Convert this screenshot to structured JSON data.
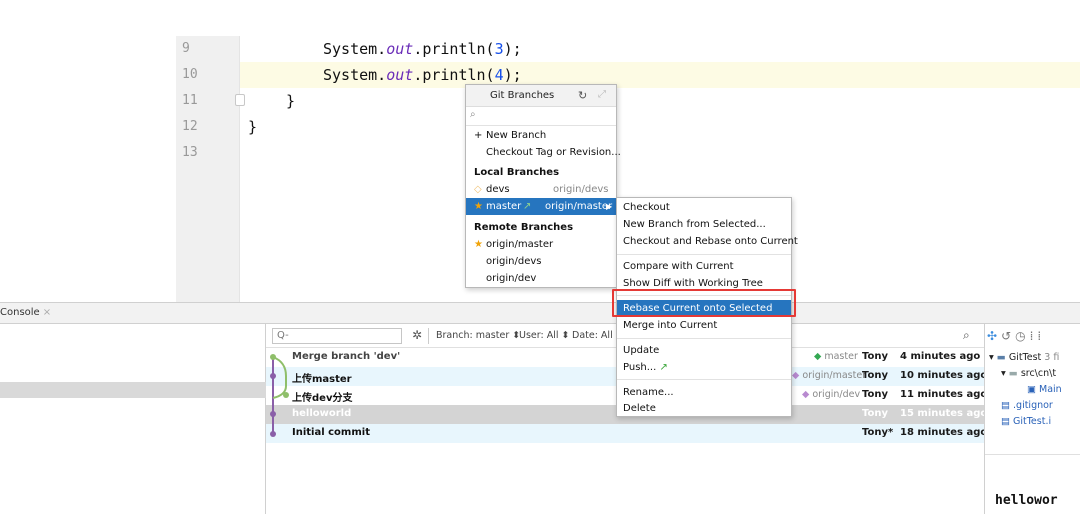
{
  "editor": {
    "line_numbers": [
      "9",
      "10",
      "11",
      "12",
      "13"
    ],
    "lines": [
      {
        "prefix": "System.",
        "field": "out",
        "mid": ".println(",
        "num": "3",
        "suffix": ");"
      },
      {
        "prefix": "System.",
        "field": "out",
        "mid": ".println(",
        "num": "4",
        "suffix": ");"
      }
    ],
    "close1": "}",
    "close2": "}"
  },
  "tool_window": {
    "console_tab": "Console",
    "close_glyph": "×"
  },
  "log_toolbar": {
    "search_placeholder": "Q-",
    "branch_filter": "Branch: master",
    "user_filter": "User: All",
    "date_filter": "Date: All"
  },
  "commits": [
    {
      "subject": "Merge branch 'dev'",
      "refs": "master",
      "author": "Tony",
      "date": "4 minutes ago"
    },
    {
      "subject": "上传master",
      "refs": "origin/master",
      "author": "Tony",
      "date": "10 minutes ago"
    },
    {
      "subject": "上传dev分支",
      "refs": "origin/dev",
      "author": "Tony",
      "date": "11 minutes ago"
    },
    {
      "subject": "helloworld",
      "refs": "",
      "author": "Tony",
      "date": "15 minutes ago"
    },
    {
      "subject": "Initial commit",
      "refs": "",
      "author": "Tony*",
      "date": "18 minutes ago"
    }
  ],
  "changes_tree": {
    "root": "GitTest",
    "root_count": "3 fi",
    "folder": "src\\cn\\t",
    "file1": "Main",
    "file2": ".gitignor",
    "file3": "GitTest.i"
  },
  "preview_text": "hellowor",
  "git_branches_popup": {
    "title": "Git Branches",
    "new_branch": "New Branch",
    "checkout_tag": "Checkout Tag or Revision...",
    "local_header": "Local Branches",
    "local": [
      {
        "name": "devs",
        "tracking": "origin/devs"
      },
      {
        "name": "master",
        "tracking": "origin/master"
      }
    ],
    "remote_header": "Remote Branches",
    "remote": [
      "origin/master",
      "origin/devs",
      "origin/dev"
    ]
  },
  "context_menu": {
    "items": [
      "Checkout",
      "New Branch from Selected...",
      "Checkout and Rebase onto Current",
      "Compare with Current",
      "Show Diff with Working Tree",
      "Rebase Current onto Selected",
      "Merge into Current",
      "Update",
      "Push...",
      "Rename...",
      "Delete"
    ],
    "selected_index": 5
  },
  "colors": {
    "selection": "#2675bf",
    "highlight_box": "#e53935",
    "graph_line": "#8a5fa8",
    "row_blue": "#e8f6fd",
    "row_gray": "#d4d4d4"
  }
}
